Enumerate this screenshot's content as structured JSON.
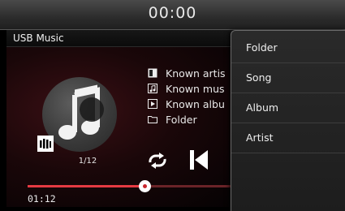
{
  "status": {
    "time": "00:00"
  },
  "player": {
    "source_title": "USB Music",
    "info": [
      {
        "icon": "artist-icon",
        "text": "Known artis"
      },
      {
        "icon": "music-note-icon",
        "text": "Known mus"
      },
      {
        "icon": "album-icon",
        "text": "Known albu"
      },
      {
        "icon": "folder-icon",
        "text": "Folder"
      }
    ],
    "track_counter": "1/12",
    "elapsed": "01:12",
    "progress": 0.56,
    "controls": [
      "repeat-icon",
      "previous-track-icon"
    ],
    "mode_icon": "playlist-mode-icon"
  },
  "menu": {
    "items": [
      "Folder",
      "Song",
      "Album",
      "Artist"
    ]
  },
  "colors": {
    "accent": "#e53a42",
    "background": "#000000"
  }
}
